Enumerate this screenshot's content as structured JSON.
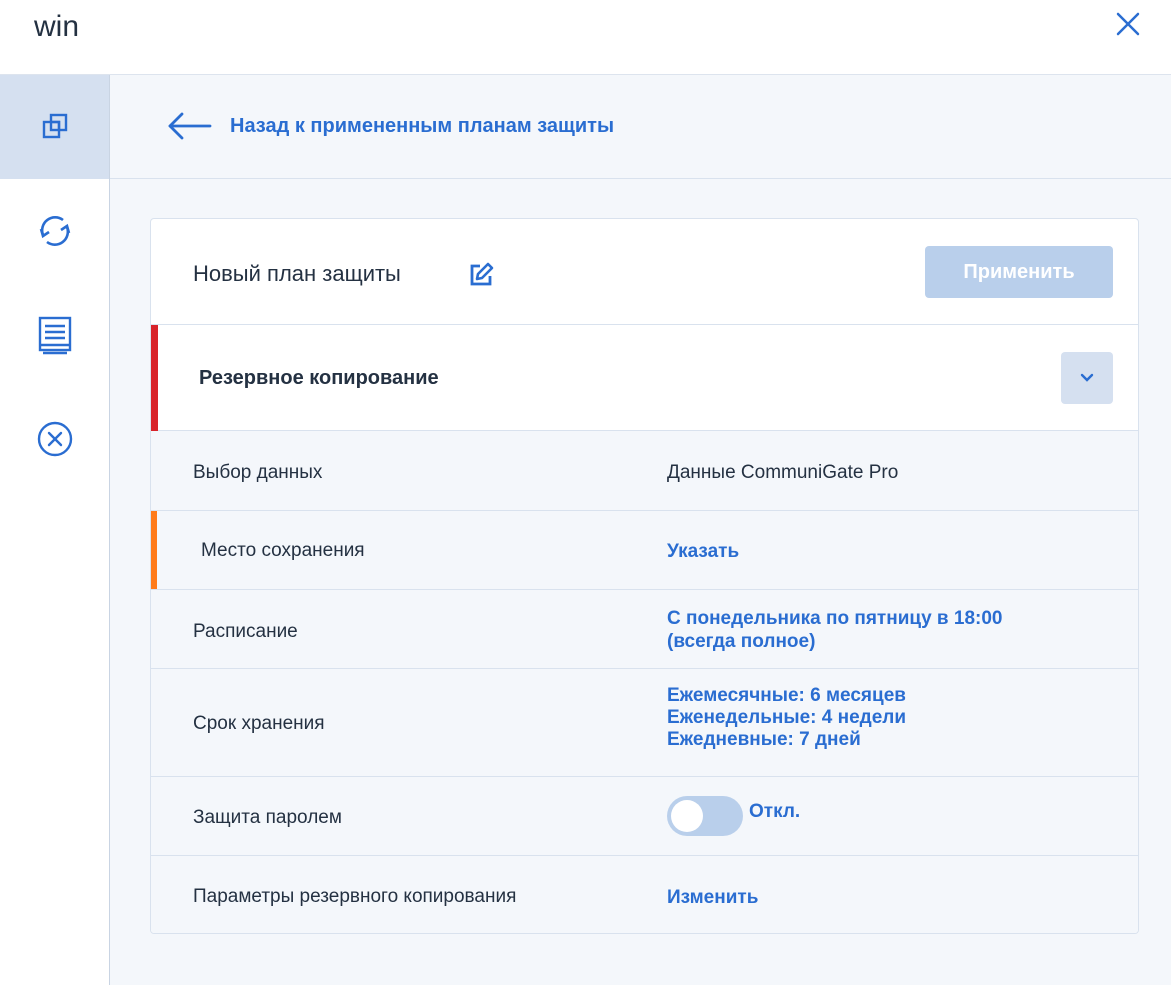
{
  "window": {
    "title": "win",
    "close_icon": "close-icon"
  },
  "sidebar": {
    "items": [
      {
        "name": "protection-plans",
        "icon": "stacked-squares-icon",
        "active": true
      },
      {
        "name": "sync",
        "icon": "refresh-icon",
        "active": false
      },
      {
        "name": "activities",
        "icon": "log-list-icon",
        "active": false
      },
      {
        "name": "cancel",
        "icon": "circle-x-icon",
        "active": false
      }
    ]
  },
  "back": {
    "label": "Назад к примененным планам защиты",
    "icon": "arrow-left-icon"
  },
  "plan": {
    "name": "Новый план защиты",
    "edit_icon": "pencil-edit-icon",
    "apply_label": "Применить"
  },
  "section": {
    "title": "Резервное копирование",
    "chevron_icon": "chevron-down-icon",
    "accent": "#d8232a"
  },
  "rows": {
    "data_selection": {
      "label": "Выбор данных",
      "value": "Данные CommuniGate Pro"
    },
    "destination": {
      "label": "Место сохранения",
      "value": "Указать",
      "accent": "#ff7b1a"
    },
    "schedule": {
      "label": "Расписание",
      "value_line1": "С понедельника по пятницу в 18:00",
      "value_line2": "(всегда полное)"
    },
    "retention": {
      "label": "Срок хранения",
      "line1": "Ежемесячные: 6 месяцев",
      "line2": "Еженедельные: 4 недели",
      "line3": "Ежедневные: 7 дней"
    },
    "password": {
      "label": "Защита паролем",
      "state": "Откл.",
      "enabled": false
    },
    "backup_options": {
      "label": "Параметры резервного копирования",
      "value": "Изменить"
    }
  },
  "colors": {
    "link": "#2a6dd1",
    "text": "#243142",
    "button_disabled": "#b9cfeb"
  }
}
